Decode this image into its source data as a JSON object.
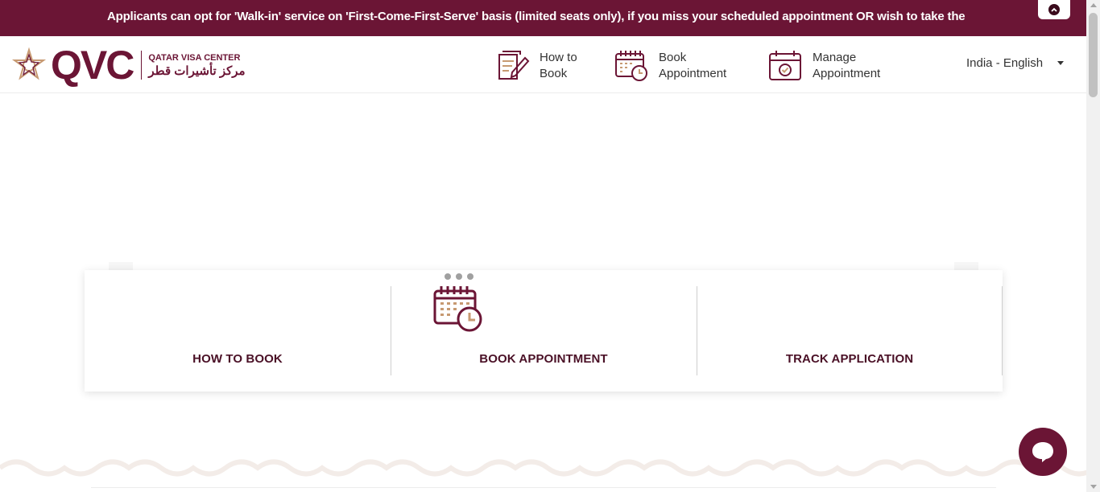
{
  "ticker": {
    "text": "Applicants can opt for 'Walk-in' service on 'First-Come-First-Serve' basis (limited seats only), if you miss your scheduled appointment OR wish to take the"
  },
  "header": {
    "logo": {
      "mark": "QVC",
      "name_en": "QATAR VISA CENTER",
      "name_ar": "مركز تأشيرات قطر"
    },
    "nav": [
      {
        "line1": "How to",
        "line2": "Book",
        "icon": "document-pen-icon"
      },
      {
        "line1": "Book",
        "line2": "Appointment",
        "icon": "calendar-clock-icon"
      },
      {
        "line1": "Manage",
        "line2": "Appointment",
        "icon": "calendar-check-icon"
      }
    ],
    "language": "India - English"
  },
  "cards": [
    {
      "title": "HOW TO BOOK"
    },
    {
      "title": "BOOK APPOINTMENT",
      "icon": "calendar-clock-icon"
    },
    {
      "title": "TRACK APPLICATION"
    }
  ],
  "colors": {
    "brand": "#6b1535",
    "card_title": "#4a1026",
    "icon_accent": "#c79a72"
  }
}
